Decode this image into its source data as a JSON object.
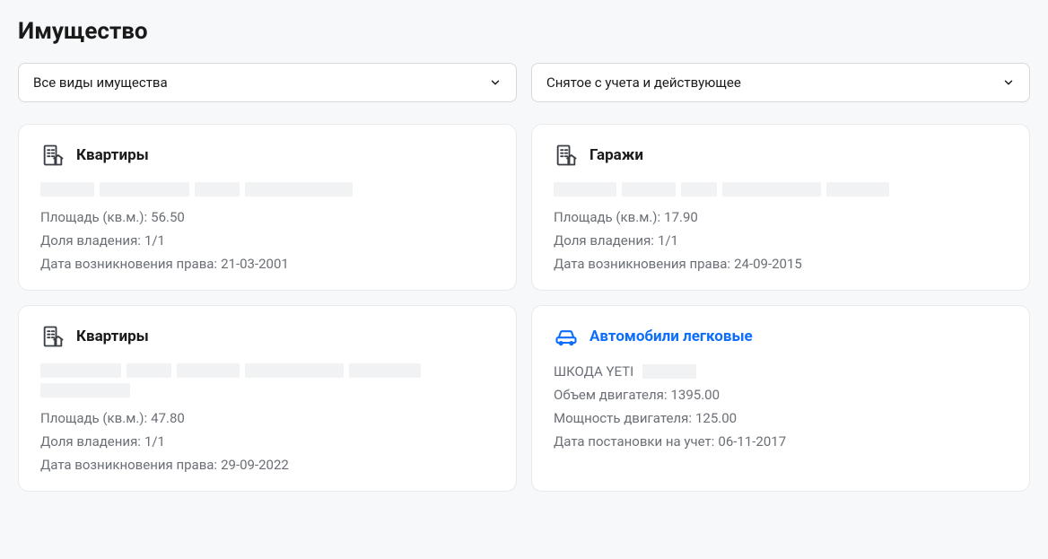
{
  "title": "Имущество",
  "filters": {
    "type": "Все виды имущества",
    "status": "Снятое с учета и действующее"
  },
  "labels": {
    "area": "Площадь (кв.м.):",
    "share": "Доля владения:",
    "rightDate": "Дата возникновения права:",
    "engineVolume": "Объем двигателя:",
    "power": "Мощность двигателя:",
    "regDate": "Дата постановки на учет:"
  },
  "cards": [
    {
      "title": "Квартиры",
      "area": "56.50",
      "share": "1/1",
      "rightDate": "21-03-2001"
    },
    {
      "title": "Гаражи",
      "area": "17.90",
      "share": "1/1",
      "rightDate": "24-09-2015"
    },
    {
      "title": "Квартиры",
      "area": "47.80",
      "share": "1/1",
      "rightDate": "29-09-2022"
    },
    {
      "title": "Автомобили легковые",
      "vehicle": "ШКОДА YETI",
      "engineVolume": "1395.00",
      "power": "125.00",
      "regDate": "06-11-2017"
    }
  ]
}
